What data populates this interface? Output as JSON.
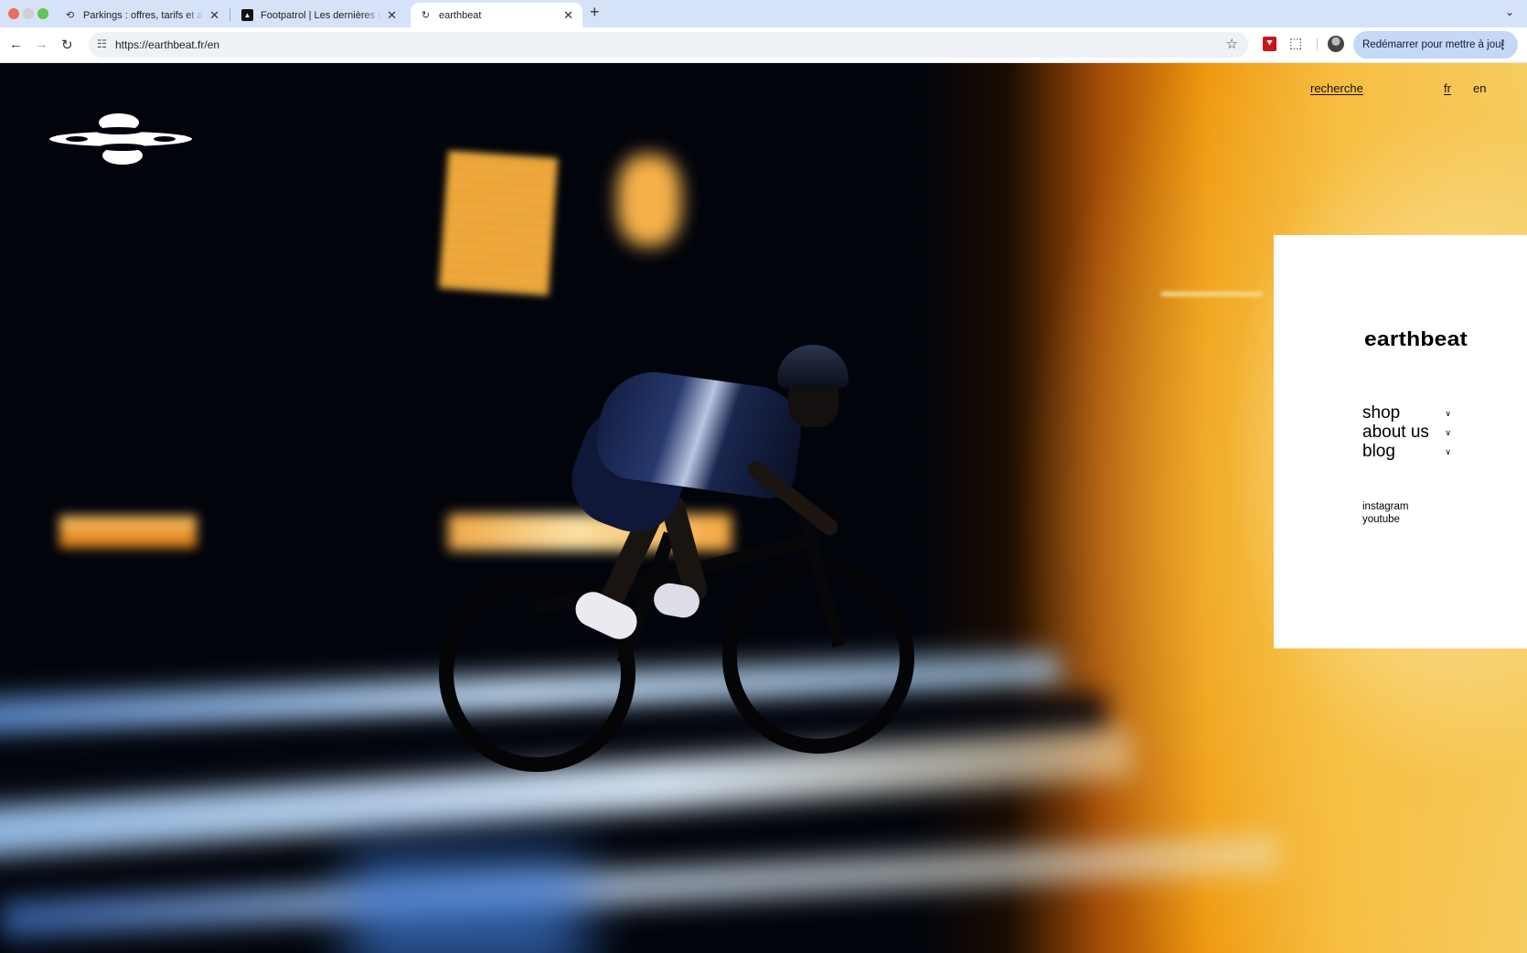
{
  "browser": {
    "tabs": [
      {
        "title": "Parkings : offres, tarifs et abonnements",
        "active": false
      },
      {
        "title": "Footpatrol | Les dernières nouveautés",
        "active": false
      },
      {
        "title": "earthbeat",
        "active": true
      }
    ],
    "url": "https://earthbeat.fr/en",
    "update_button": "Redémarrer pour mettre à jour"
  },
  "site": {
    "search_link": "recherche",
    "languages": [
      "fr",
      "en"
    ],
    "active_language": "en",
    "brand": "earthbeat",
    "menu": [
      {
        "label": "shop"
      },
      {
        "label": "about us"
      },
      {
        "label": "blog"
      }
    ],
    "socials": [
      "instagram",
      "youtube"
    ]
  },
  "icons": {
    "back": "arrow-left-icon",
    "forward": "arrow-right-icon",
    "reload": "reload-icon",
    "site_controls": "tune-icon",
    "bookmark": "star-icon",
    "menu_chevron": "chevron-down-icon"
  },
  "colors": {
    "tabstrip": "#d6e2f8",
    "update_button": "#c5d8f5",
    "hero_orange": "#ee960d"
  }
}
